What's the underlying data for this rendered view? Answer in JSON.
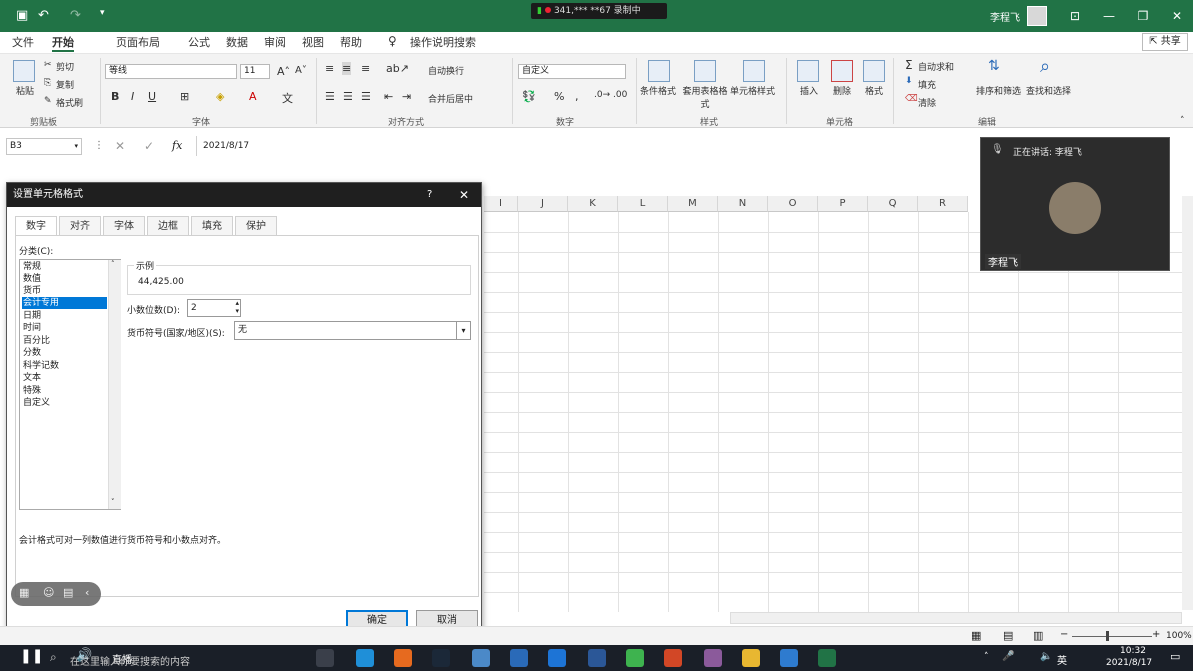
{
  "window": {
    "recording_status": "341,*** **67 录制中",
    "user_name": "李程飞"
  },
  "menu": [
    "文件",
    "开始",
    "页面布局",
    "公式",
    "数据",
    "审阅",
    "视图",
    "帮助"
  ],
  "tell_me": "操作说明搜索",
  "share_label": "共享",
  "ribbon": {
    "clipboard": {
      "paste": "粘贴",
      "cut": "剪切",
      "copy": "复制",
      "format_painter": "格式刷",
      "group": "剪贴板"
    },
    "font": {
      "name": "等线",
      "size": "11",
      "group": "字体"
    },
    "alignment": {
      "wrap": "自动换行",
      "merge": "合并后居中",
      "group": "对齐方式"
    },
    "number": {
      "format": "自定义",
      "group": "数字"
    },
    "styles": {
      "conditional": "条件格式",
      "table": "套用表格格式",
      "cell_styles": "单元格样式",
      "group": "样式"
    },
    "cells": {
      "insert": "插入",
      "delete": "删除",
      "format": "格式",
      "group": "单元格"
    },
    "editing": {
      "autosum": "自动求和",
      "fill": "填充",
      "clear": "清除",
      "sort": "排序和筛选",
      "find": "查找和选择",
      "group": "编辑"
    }
  },
  "formula_bar": {
    "name_box": "B3",
    "value": "2021/8/17"
  },
  "columns": [
    "I",
    "J",
    "K",
    "L",
    "M",
    "N",
    "O",
    "P",
    "Q",
    "R"
  ],
  "dialog": {
    "title": "设置单元格格式",
    "help": "?",
    "tabs": [
      "数字",
      "对齐",
      "字体",
      "边框",
      "填充",
      "保护"
    ],
    "category_label": "分类(C):",
    "categories": [
      "常规",
      "数值",
      "货币",
      "会计专用",
      "日期",
      "时间",
      "百分比",
      "分数",
      "科学记数",
      "文本",
      "特殊",
      "自定义"
    ],
    "selected_category": 3,
    "sample_label": "示例",
    "sample_value": "44,425.00",
    "decimal_label": "小数位数(D):",
    "decimal_value": "2",
    "currency_label": "货币符号(国家/地区)(S):",
    "currency_value": "无",
    "description": "会计格式可对一列数值进行货币符号和小数点对齐。",
    "ok": "确定",
    "cancel": "取消"
  },
  "video": {
    "speaking": "正在讲话: 李程飞",
    "speaker": "李程飞"
  },
  "statusbar": {
    "zoom": "100%"
  },
  "taskbar": {
    "live_label": "直播",
    "search_placeholder": "在这里输入你要搜索的内容",
    "lang": "英",
    "time": "10:32",
    "date": "2021/8/17"
  }
}
